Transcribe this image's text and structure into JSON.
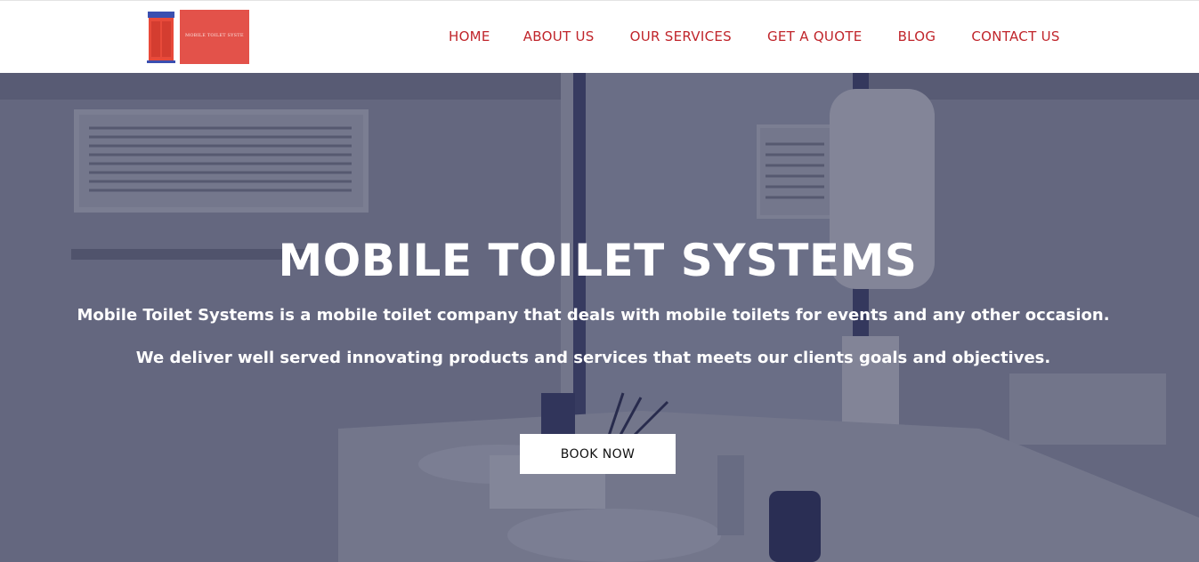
{
  "header": {
    "logo": {
      "text": "MOBILE TOILET SYSTEMS",
      "image": "portable-toilet-icon"
    },
    "nav": [
      {
        "label": "HOME"
      },
      {
        "label": "ABOUT US"
      },
      {
        "label": "OUR SERVICES"
      },
      {
        "label": "GET A QUOTE"
      },
      {
        "label": "BLOG"
      },
      {
        "label": "CONTACT US"
      }
    ]
  },
  "hero": {
    "title": "MOBILE TOILET SYSTEMS",
    "line1": "Mobile Toilet Systems is a mobile toilet company that deals with mobile toilets for events and any other occasion.",
    "line2": "We deliver well served innovating products and services that meets our clients goals and objectives.",
    "button": "BOOK NOW",
    "background": "washroom-interior-photo"
  },
  "colors": {
    "nav_text": "#c0252b",
    "logo_banner": "#e3524a",
    "hero_overlay": "#262a48",
    "button_bg": "#ffffff"
  }
}
